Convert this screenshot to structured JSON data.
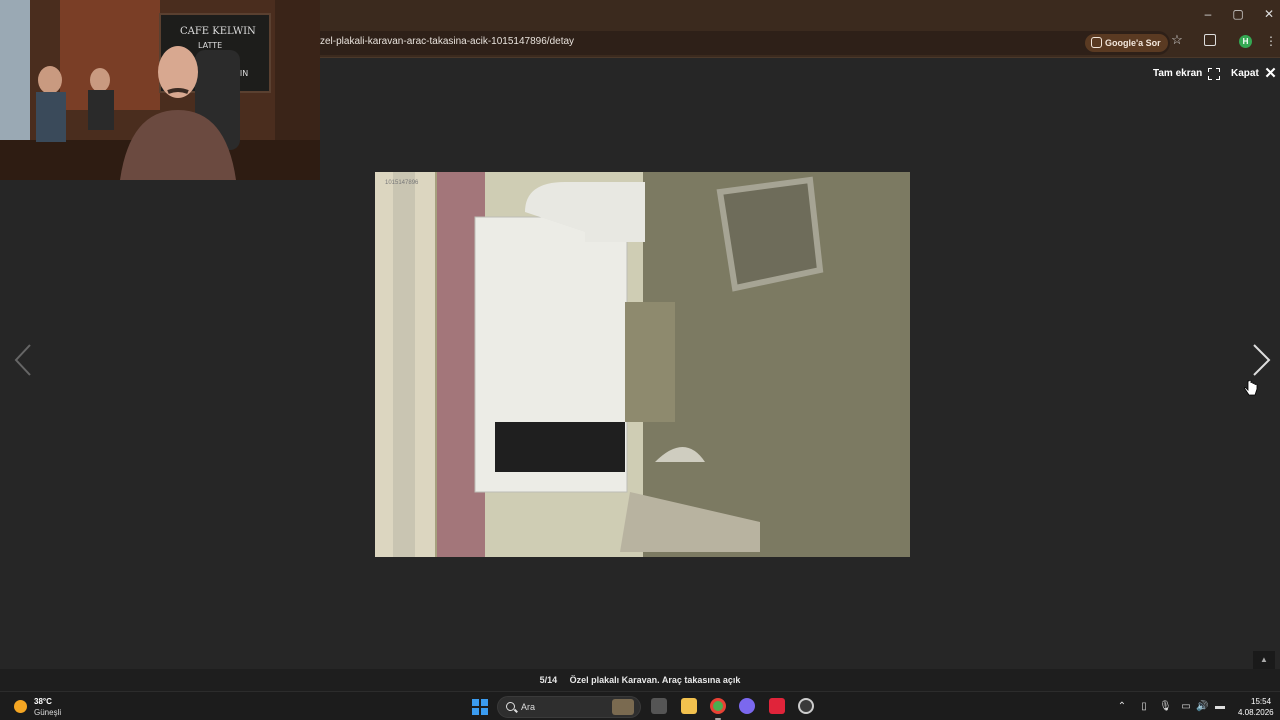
{
  "browser": {
    "url": "zel-plakali-karavan-arac-takasina-acik-1015147896/detay",
    "google_sor_label": "Google'a Sor",
    "profile_initial": "H",
    "window_controls": {
      "minimize": "–",
      "maximize": "▢",
      "close": "✕"
    }
  },
  "viewer": {
    "fullscreen_label": "Tam ekran",
    "close_label": "Kapat",
    "counter": "5/14",
    "caption": "Özel plakalı Karavan. Araç takasına açık",
    "watermark_id": "1015147896",
    "scroll_top_label": "▲"
  },
  "webcam": {
    "sign_line1": "CAFE KELWIN",
    "sign_line2": "LATTE",
    "sign_line3": "KELWIN"
  },
  "taskbar": {
    "weather_temp": "38°C",
    "weather_condition": "Güneşli",
    "search_placeholder": "Ara",
    "clock_time": "15:54",
    "clock_date": "4.08.2026"
  },
  "colors": {
    "browser_frame": "#3b2a1e",
    "viewer_bg": "#262626",
    "accent_windows": "#3b9cf0"
  }
}
